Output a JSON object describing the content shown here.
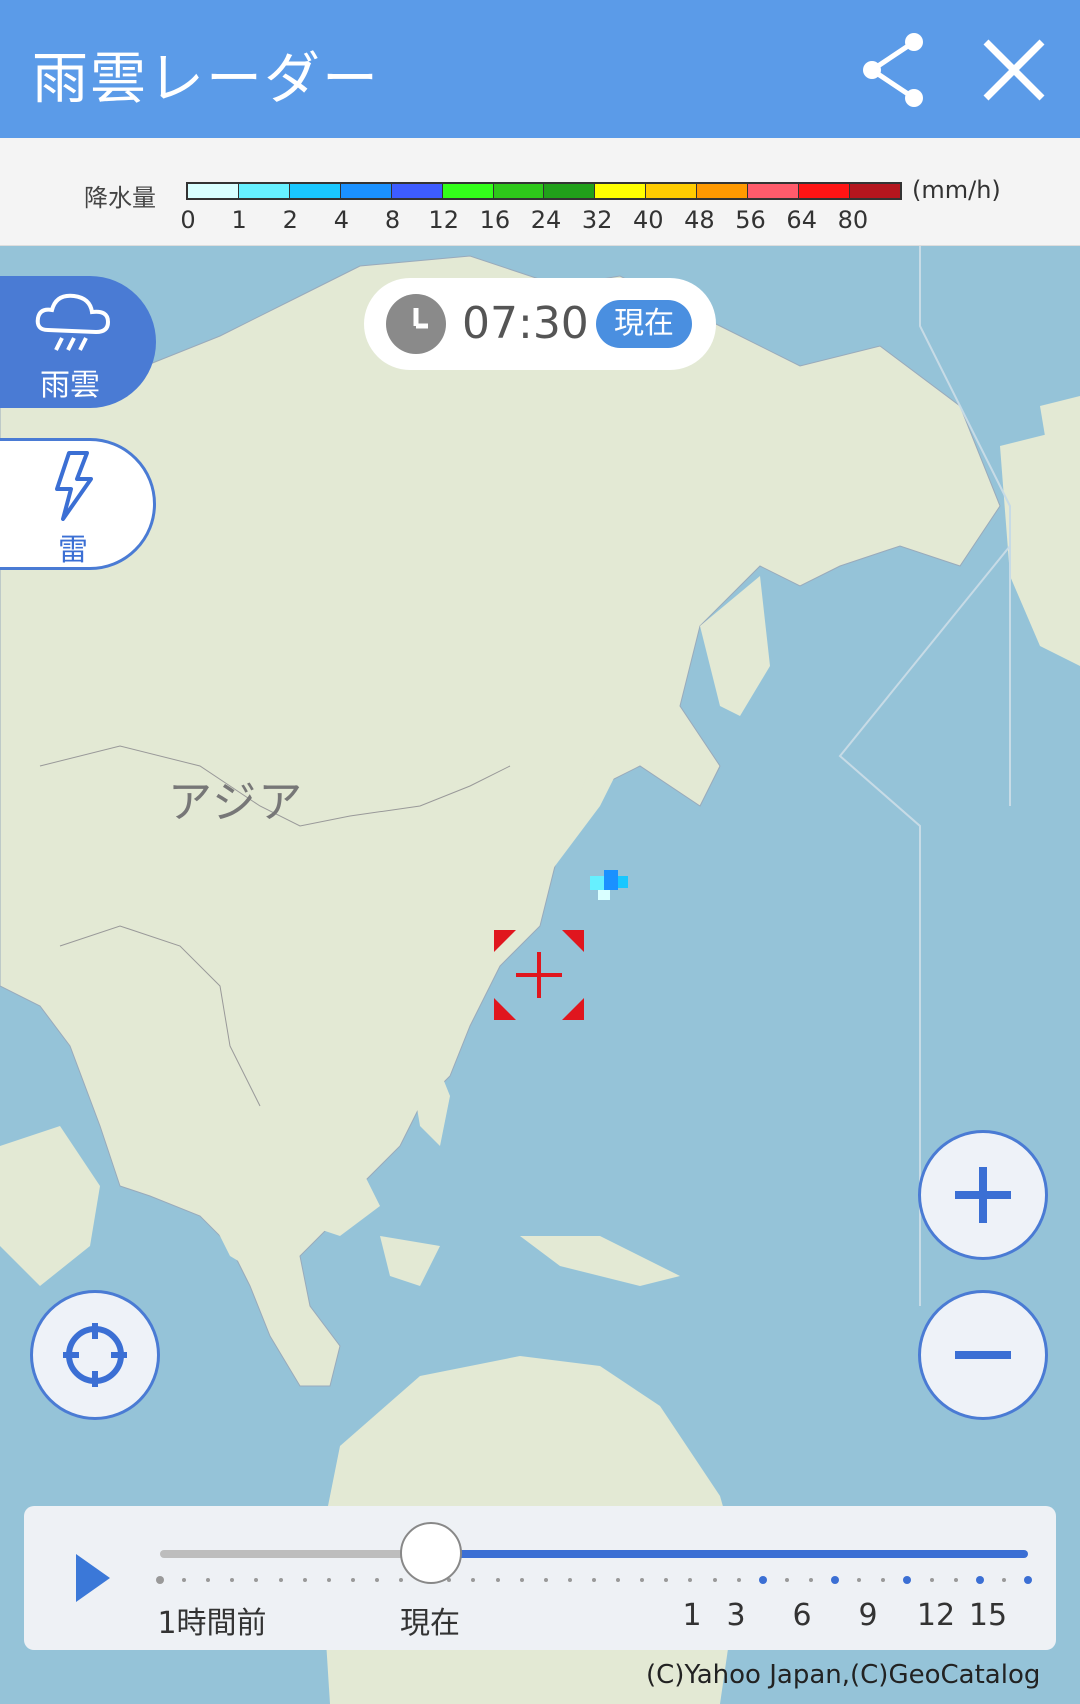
{
  "header": {
    "title": "雨雲レーダー",
    "share_icon": "share-icon",
    "close_icon": "close-icon"
  },
  "legend": {
    "label": "降水量",
    "unit": "(mm/h)",
    "ticks": [
      "0",
      "1",
      "2",
      "4",
      "8",
      "12",
      "16",
      "24",
      "32",
      "40",
      "48",
      "56",
      "64",
      "80"
    ],
    "colors": [
      "#d9ffff",
      "#66f0ff",
      "#19c7ff",
      "#1a91ff",
      "#3d5cff",
      "#33ff1a",
      "#2ec81a",
      "#21a01a",
      "#ffff00",
      "#ffcc00",
      "#ff9900",
      "#ff5b6b",
      "#ff1414",
      "#b4161e"
    ]
  },
  "time": {
    "clock_icon": "clock-icon",
    "value": "07:30",
    "badge": "現在"
  },
  "layers": {
    "rain": {
      "label": "雨雲",
      "icon": "rain-cloud-icon"
    },
    "thunder": {
      "label": "雷",
      "icon": "lightning-icon"
    }
  },
  "map": {
    "continent_label": "アジア",
    "target_icon": "crosshair-target-icon"
  },
  "controls": {
    "locate_icon": "locate-icon",
    "zoom_in_icon": "plus-icon",
    "zoom_out_icon": "minus-icon"
  },
  "slider": {
    "play_icon": "play-icon",
    "labels": {
      "past": "1時間前",
      "now": "現在",
      "h1": "1",
      "h3": "3",
      "h6": "6",
      "h9": "9",
      "h12": "12",
      "h15": "15"
    },
    "position": 0.25
  },
  "copyright": "(C)Yahoo Japan,(C)GeoCatalog"
}
